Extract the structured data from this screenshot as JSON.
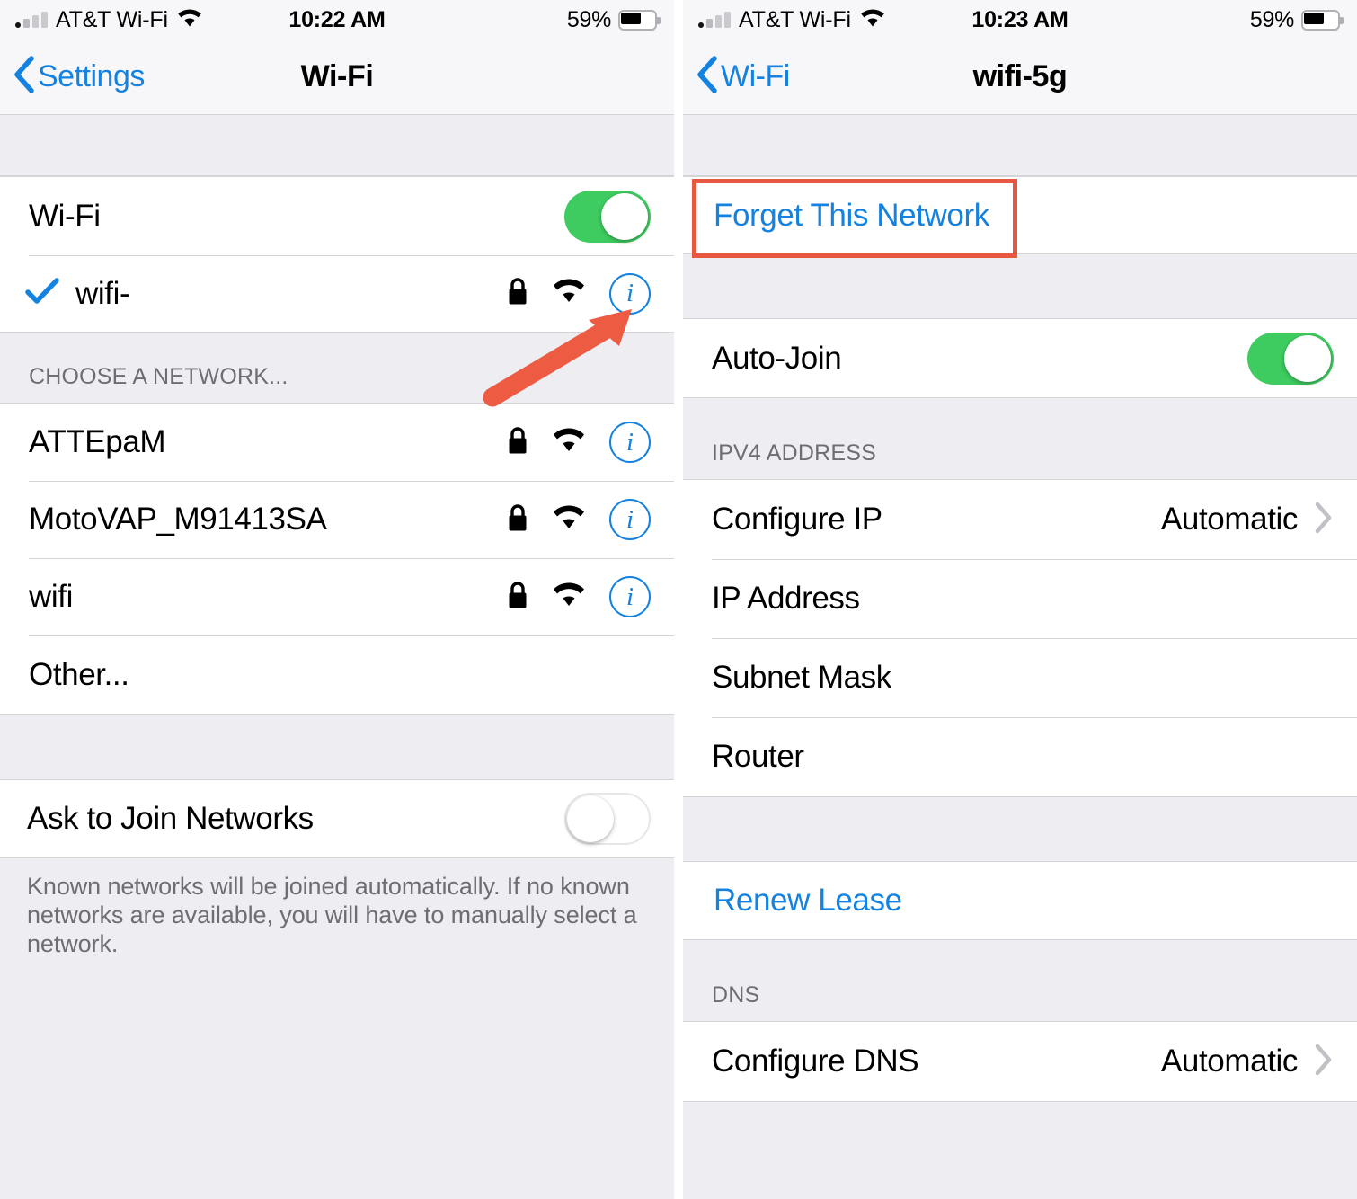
{
  "left": {
    "status": {
      "carrier": "AT&T Wi-Fi",
      "time": "10:22 AM",
      "battery_pct": "59%",
      "battery_level": 59,
      "signal_icon": "cellular-bars-icon",
      "wifi_icon": "wifi-icon",
      "battery_icon": "battery-icon"
    },
    "nav": {
      "back_label": "Settings",
      "back_icon": "chevron-left-icon",
      "title": "Wi-Fi"
    },
    "wifi_toggle": {
      "label": "Wi-Fi",
      "state": "on"
    },
    "connected_network": {
      "name": "wifi-",
      "checked": true,
      "check_icon": "checkmark-icon",
      "lock_icon": "lock-icon",
      "signal_icon": "wifi-signal-icon",
      "info_icon": "info-circle-icon"
    },
    "choose_header": "CHOOSE A NETWORK...",
    "networks": [
      {
        "name": "ATTEpaM",
        "lock_icon": "lock-icon",
        "signal_icon": "wifi-signal-icon",
        "info_icon": "info-circle-icon",
        "secured": true
      },
      {
        "name": "MotoVAP_M91413SA",
        "lock_icon": "lock-icon",
        "signal_icon": "wifi-signal-icon",
        "info_icon": "info-circle-icon",
        "secured": true
      },
      {
        "name": "wifi",
        "lock_icon": "lock-icon",
        "signal_icon": "wifi-signal-icon",
        "info_icon": "info-circle-icon",
        "secured": true
      },
      {
        "name": "Other...",
        "secured": false
      }
    ],
    "ask_to_join": {
      "label": "Ask to Join Networks",
      "state": "off"
    },
    "footnote": "Known networks will be joined automatically. If no known networks are available, you will have to manually select a network."
  },
  "right": {
    "status": {
      "carrier": "AT&T Wi-Fi",
      "time": "10:23 AM",
      "battery_pct": "59%",
      "battery_level": 59,
      "signal_icon": "cellular-bars-icon",
      "wifi_icon": "wifi-icon",
      "battery_icon": "battery-icon"
    },
    "nav": {
      "back_label": "Wi-Fi",
      "back_icon": "chevron-left-icon",
      "title": "wifi-5g"
    },
    "forget_network": {
      "label": "Forget This Network",
      "highlighted": true
    },
    "auto_join": {
      "label": "Auto-Join",
      "state": "on"
    },
    "ipv4_header": "IPV4 ADDRESS",
    "ipv4_rows": [
      {
        "label": "Configure IP",
        "value": "Automatic",
        "chevron": "chevron-right-icon"
      },
      {
        "label": "IP Address",
        "value": ""
      },
      {
        "label": "Subnet Mask",
        "value": ""
      },
      {
        "label": "Router",
        "value": ""
      }
    ],
    "renew_lease": {
      "label": "Renew Lease"
    },
    "dns_header": "DNS",
    "dns_rows": [
      {
        "label": "Configure DNS",
        "value": "Automatic",
        "chevron": "chevron-right-icon"
      }
    ]
  },
  "annotation": {
    "arrow_color": "#ec5b42",
    "highlight_color": "#e8573f",
    "arrow_icon": "red-arrow-icon",
    "highlight_icon": "red-highlight-box"
  },
  "colors": {
    "accent_blue": "#1482e0",
    "toggle_green": "#3ecb5f",
    "annotation_red": "#e8573f",
    "group_bg": "#ffffff",
    "page_bg": "#eeeef2"
  }
}
